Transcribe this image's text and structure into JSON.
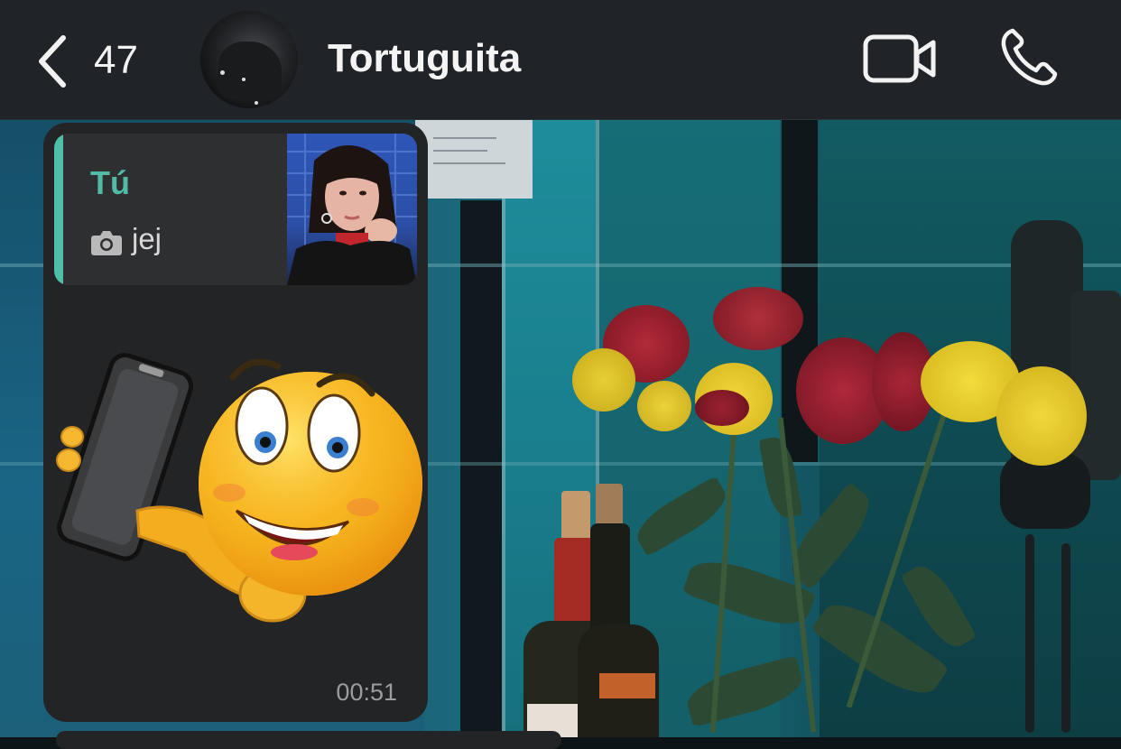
{
  "header": {
    "back_count": "47",
    "contact_name": "Tortuguita"
  },
  "message": {
    "reply": {
      "author": "Tú",
      "text": "jej",
      "media_icon": "camera-icon"
    },
    "sticker": "emoji-selfie-sticker",
    "time": "00:51"
  },
  "colors": {
    "header_bg": "#202428",
    "bubble_bg": "#232425",
    "accent": "#4fbfa8",
    "time_text": "#9b9d9f"
  }
}
